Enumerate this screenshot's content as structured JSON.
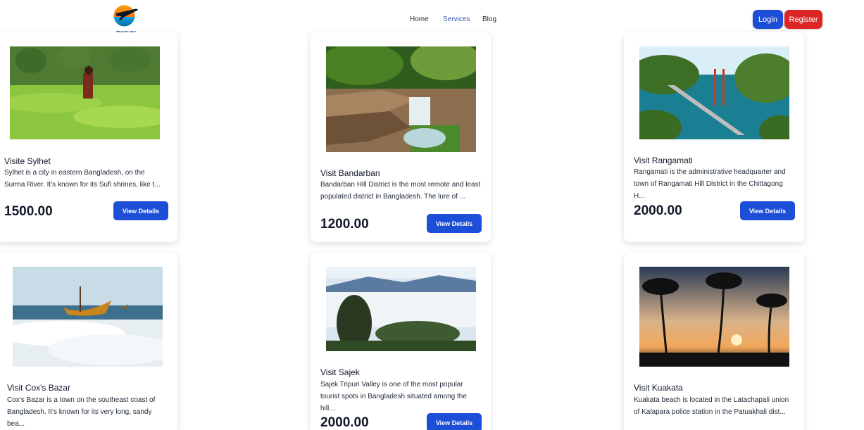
{
  "nav": {
    "logo_text": "TRAVELING",
    "links": [
      "Home",
      "Services",
      "Blog"
    ],
    "login": "Login",
    "register": "Register",
    "accent": "#1d4ed8",
    "register_color": "#dc2626"
  },
  "cards": [
    {
      "title": "Visite Sylhet",
      "desc": "Sylhet is a city in eastern Bangladesh, on the Surma River. It’s known for its Sufi shrines, like t...",
      "price": "1500.00",
      "button": "View Details"
    },
    {
      "title": "Visit Bandarban",
      "desc": "Bandarban Hill District is the most remote and least populated district in Bangladesh. The lure of ...",
      "price": "1200.00",
      "button": "View Details"
    },
    {
      "title": "Visit Rangamati",
      "desc": "Rangamati is the administrative headquarter and town of Rangamati Hill District in the Chittagong H...",
      "price": "2000.00",
      "button": "View Details"
    },
    {
      "title": "Visit Cox's Bazar",
      "desc": "Cox's Bazar is a town on the southeast coast of Bangladesh. It’s known for its very long, sandy bea...",
      "price": "",
      "button": ""
    },
    {
      "title": "Visit Sajek",
      "desc": "Sajek Tripuri Valley is one of the most popular tourist spots in Bangladesh situated among the hill...",
      "price": "2000.00",
      "button": "View Details"
    },
    {
      "title": "Visit Kuakata",
      "desc": "Kuakata beach is located in the Latachapali union of Kalapara police station in the Patuakhali dist...",
      "price": "",
      "button": ""
    }
  ]
}
